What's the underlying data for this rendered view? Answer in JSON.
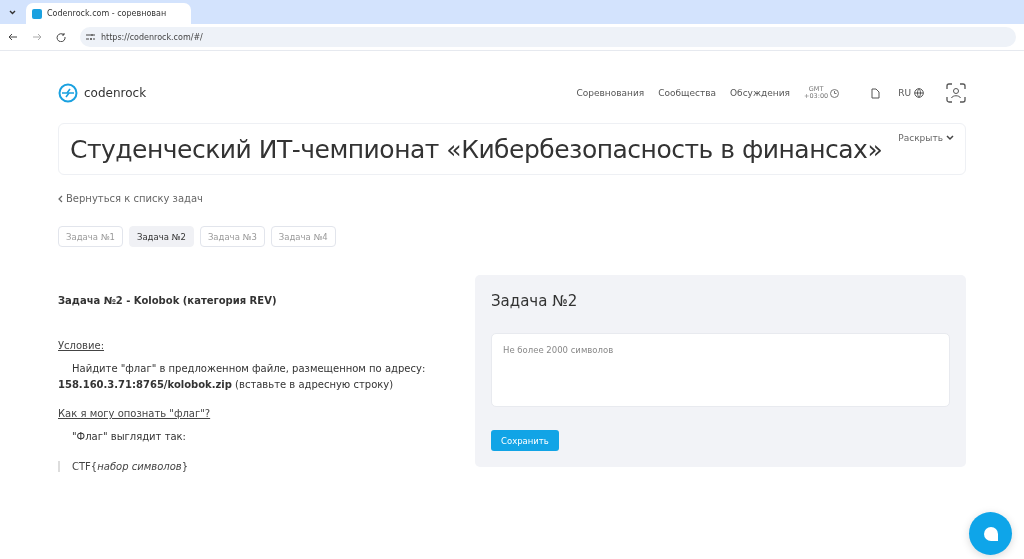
{
  "browser": {
    "tab_title": "Codenrock.com - соревнован",
    "url": "https://codenrock.com/#/"
  },
  "header": {
    "logo": "codenrock",
    "nav": [
      "Соревнования",
      "Сообщества",
      "Обсуждения"
    ],
    "timezone": [
      "GMT",
      "+03:00"
    ],
    "language": "RU"
  },
  "title_card": {
    "title": "Студенческий ИТ-чемпионат «Кибербезопасность в финансах»",
    "expand": "Раскрыть"
  },
  "back_link": "Вернуться к списку задач",
  "task_tabs": [
    {
      "label": "Задача №1",
      "selected": false
    },
    {
      "label": "Задача №2",
      "selected": true
    },
    {
      "label": "Задача №3",
      "selected": false
    },
    {
      "label": "Задача №4",
      "selected": false
    }
  ],
  "description": [
    {
      "kind": "heading",
      "text": "Задача №2 - Kolobok (категория REV)"
    },
    {
      "kind": "subheading",
      "text": "Условие:"
    },
    {
      "kind": "paragraph",
      "text": "Найдите \"флаг\" в предложенном файле, размещенном по адресу: **158.160.3.71:8765/kolobok.zip** (вставьте в адресную строку)"
    },
    {
      "kind": "subheading",
      "text": "Как я могу опознать \"флаг\"?"
    },
    {
      "kind": "paragraph",
      "text": "\"Флаг\" выглядит так:"
    },
    {
      "kind": "quote",
      "text": "CTF{*набор символов*}"
    }
  ],
  "answer_panel": {
    "title": "Задача №2",
    "placeholder": "Не более 2000 символов",
    "button": "Сохранить"
  }
}
